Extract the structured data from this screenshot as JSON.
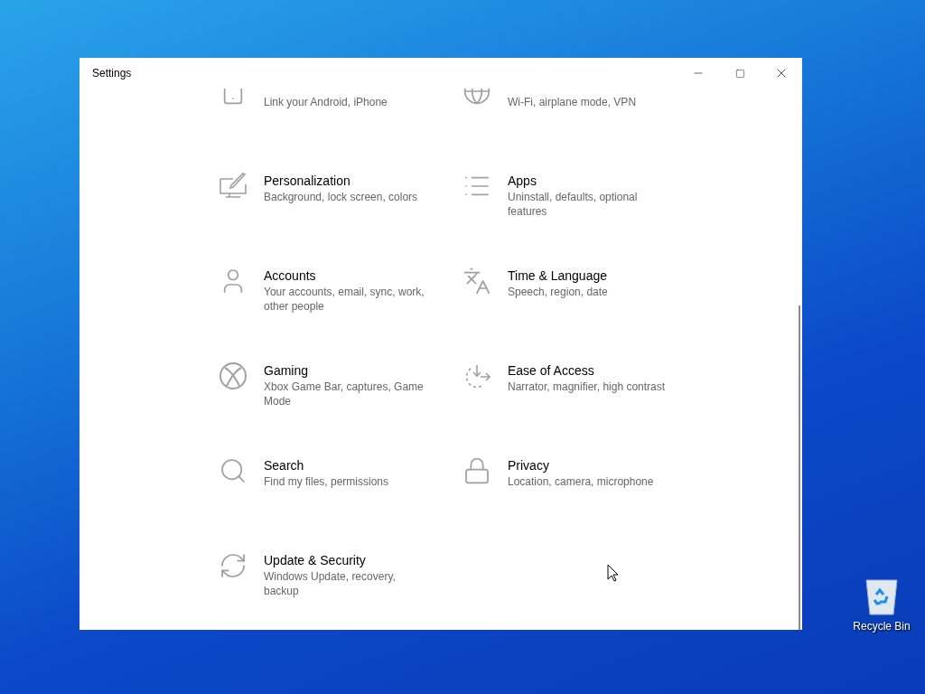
{
  "window": {
    "title": "Settings"
  },
  "categories": [
    {
      "description": "Link your Android, iPhone"
    },
    {
      "description": "Wi-Fi, airplane mode, VPN"
    },
    {
      "title": "Personalization",
      "description": "Background, lock screen, colors"
    },
    {
      "title": "Apps",
      "description": "Uninstall, defaults, optional features"
    },
    {
      "title": "Accounts",
      "description": "Your accounts, email, sync, work, other people"
    },
    {
      "title": "Time & Language",
      "description": "Speech, region, date"
    },
    {
      "title": "Gaming",
      "description": "Xbox Game Bar, captures, Game Mode"
    },
    {
      "title": "Ease of Access",
      "description": "Narrator, magnifier, high contrast"
    },
    {
      "title": "Search",
      "description": "Find my files, permissions"
    },
    {
      "title": "Privacy",
      "description": "Location, camera, microphone"
    },
    {
      "title": "Update & Security",
      "description": "Windows Update, recovery, backup"
    }
  ],
  "desktop_icons": [
    {
      "label": "Recycle Bin"
    }
  ]
}
